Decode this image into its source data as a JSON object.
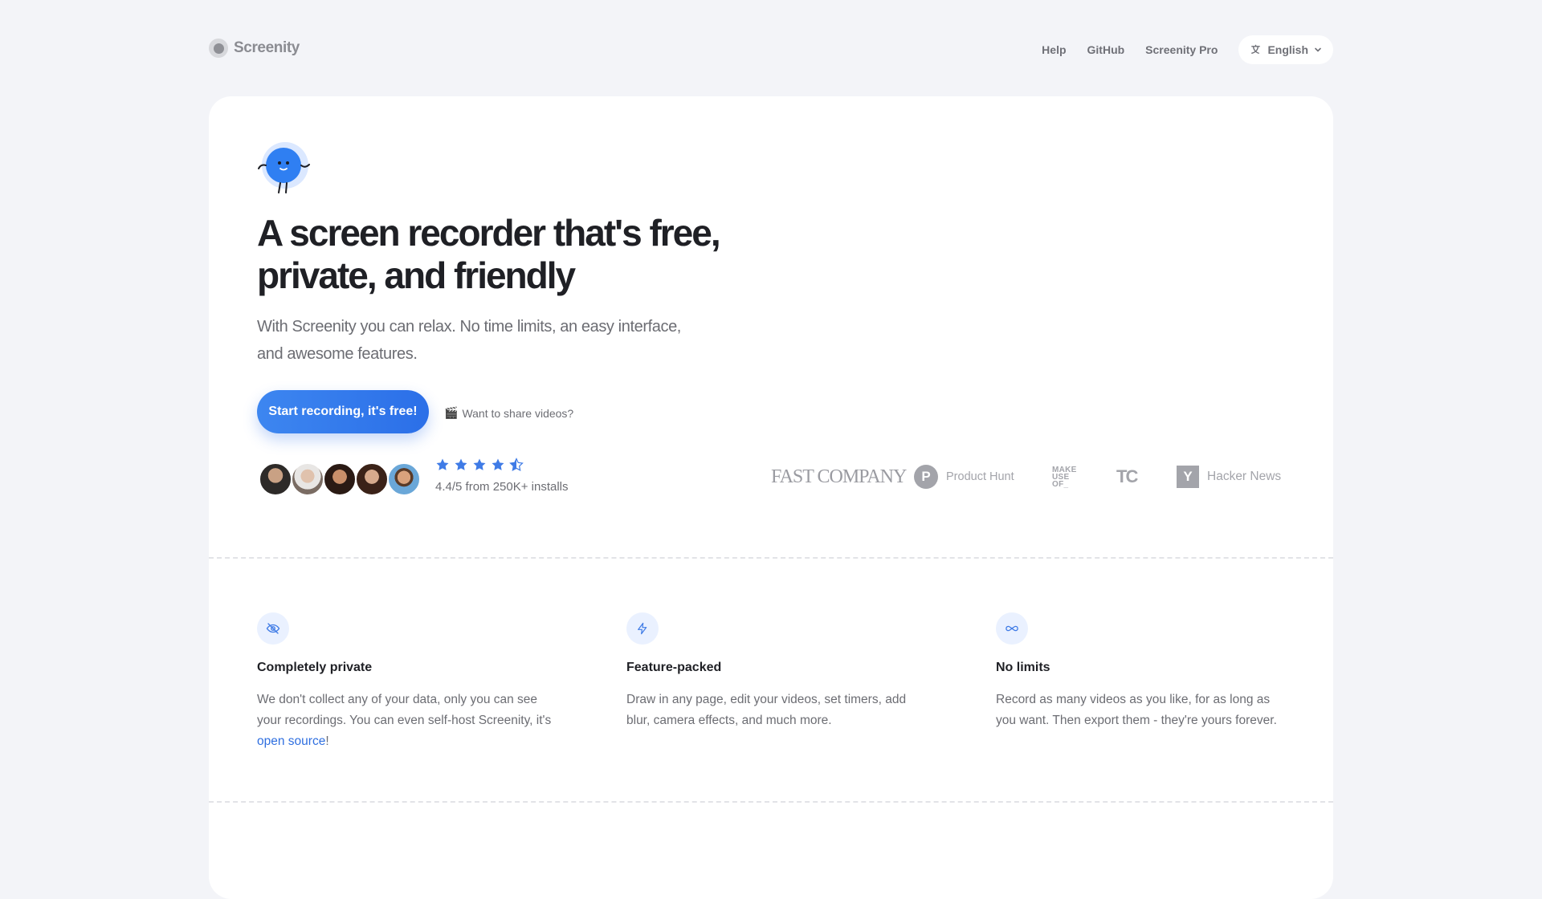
{
  "nav": {
    "brand": "Screenity",
    "links": [
      "Help",
      "GitHub",
      "Screenity Pro"
    ],
    "language": "English"
  },
  "hero": {
    "title": "A screen recorder that's free, private, and friendly",
    "subtitle": "With Screenity you can relax. No time limits, an easy interface, and awesome features.",
    "cta_label": "Start recording, it's free!",
    "share_label": "Want to share videos?",
    "rating_text": "4.4/5 from 250K+ installs",
    "rating_value": 4.4,
    "rating_max": 5
  },
  "press": {
    "fast_company": "FAST COMPANY",
    "product_hunt": "Product Hunt",
    "make_use_of": "MAKE USE OF_",
    "techcrunch": "TC",
    "hacker_news": "Hacker News"
  },
  "features": [
    {
      "icon": "eye-off-icon",
      "title": "Completely private",
      "desc_before": "We don't collect any of your data, only you can see your recordings. You can even self-host Screenity, it's ",
      "link": "open source",
      "desc_after": "!"
    },
    {
      "icon": "lightning-icon",
      "title": "Feature-packed",
      "desc": "Draw in any page, edit your videos, set timers, add blur, camera effects, and much more."
    },
    {
      "icon": "infinity-icon",
      "title": "No limits",
      "desc": "Record as many videos as you like, for as long as you want. Then export them - they're yours forever."
    }
  ],
  "colors": {
    "accent": "#2f6fe0",
    "background": "#f3f4f8",
    "card": "#ffffff"
  }
}
